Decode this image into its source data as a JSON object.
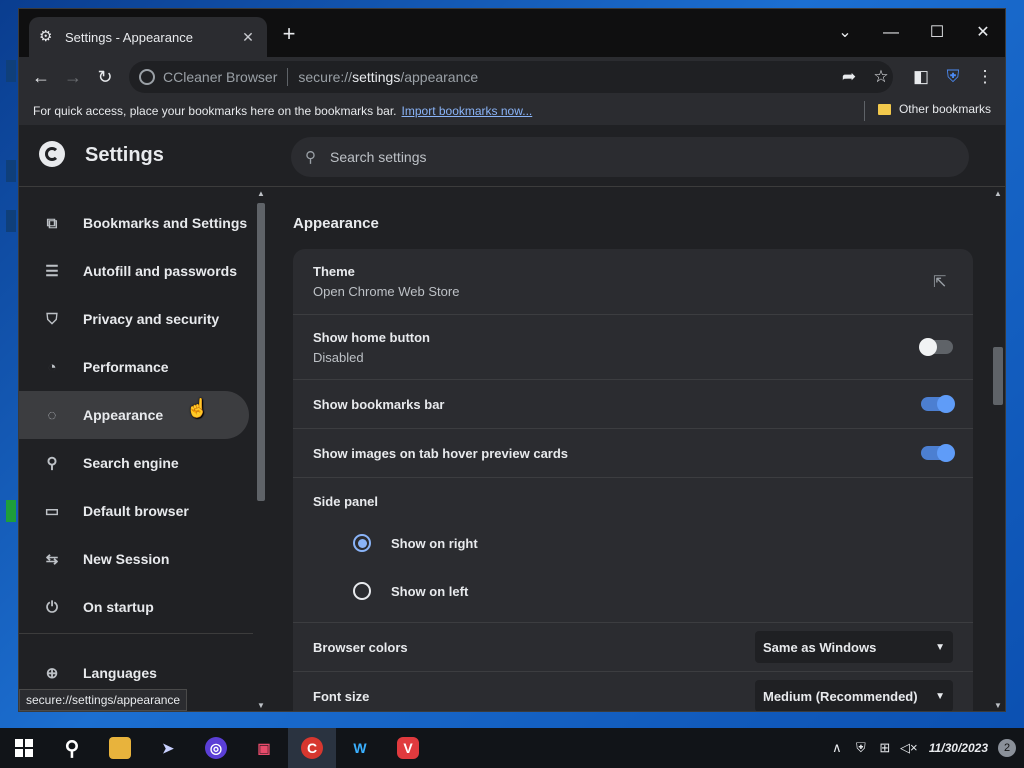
{
  "window": {
    "tab_title": "Settings - Appearance",
    "omnibox_brand": "CCleaner Browser",
    "url_prefix": "secure://",
    "url_path": "settings",
    "url_suffix": "/appearance"
  },
  "bookmarks_bar": {
    "prompt": "For quick access, place your bookmarks here on the bookmarks bar.",
    "import_link": "Import bookmarks now...",
    "other_bookmarks": "Other bookmarks"
  },
  "settings": {
    "title": "Settings",
    "search_placeholder": "Search settings"
  },
  "sidebar": {
    "items": [
      {
        "label": "Bookmarks and Settings",
        "icon": "bookmark-icon"
      },
      {
        "label": "Autofill and passwords",
        "icon": "list-icon"
      },
      {
        "label": "Privacy and security",
        "icon": "shield-icon"
      },
      {
        "label": "Performance",
        "icon": "gauge-icon"
      },
      {
        "label": "Appearance",
        "icon": "palette-icon",
        "active": true
      },
      {
        "label": "Search engine",
        "icon": "search-icon"
      },
      {
        "label": "Default browser",
        "icon": "browser-icon"
      },
      {
        "label": "New Session",
        "icon": "session-icon"
      },
      {
        "label": "On startup",
        "icon": "power-icon"
      },
      {
        "label": "Languages",
        "icon": "globe-icon"
      }
    ]
  },
  "status_url": "secure://settings/appearance",
  "appearance": {
    "section_title": "Appearance",
    "theme_label": "Theme",
    "theme_sub": "Open Chrome Web Store",
    "home_button_label": "Show home button",
    "home_button_sub": "Disabled",
    "home_button_on": false,
    "bookmarks_bar_label": "Show bookmarks bar",
    "bookmarks_bar_on": true,
    "tab_hover_label": "Show images on tab hover preview cards",
    "tab_hover_on": true,
    "side_panel_label": "Side panel",
    "side_panel_right": "Show on right",
    "side_panel_left": "Show on left",
    "side_panel_selected": "right",
    "browser_colors_label": "Browser colors",
    "browser_colors_value": "Same as Windows",
    "font_size_label": "Font size",
    "font_size_value": "Medium (Recommended)"
  },
  "taskbar": {
    "date": "11/30/2023",
    "notification_count": "2"
  },
  "colors": {
    "accent": "#8ab4f8",
    "toggle_on": "#4c7fd1",
    "background": "#202124",
    "card": "#2b2c30"
  }
}
